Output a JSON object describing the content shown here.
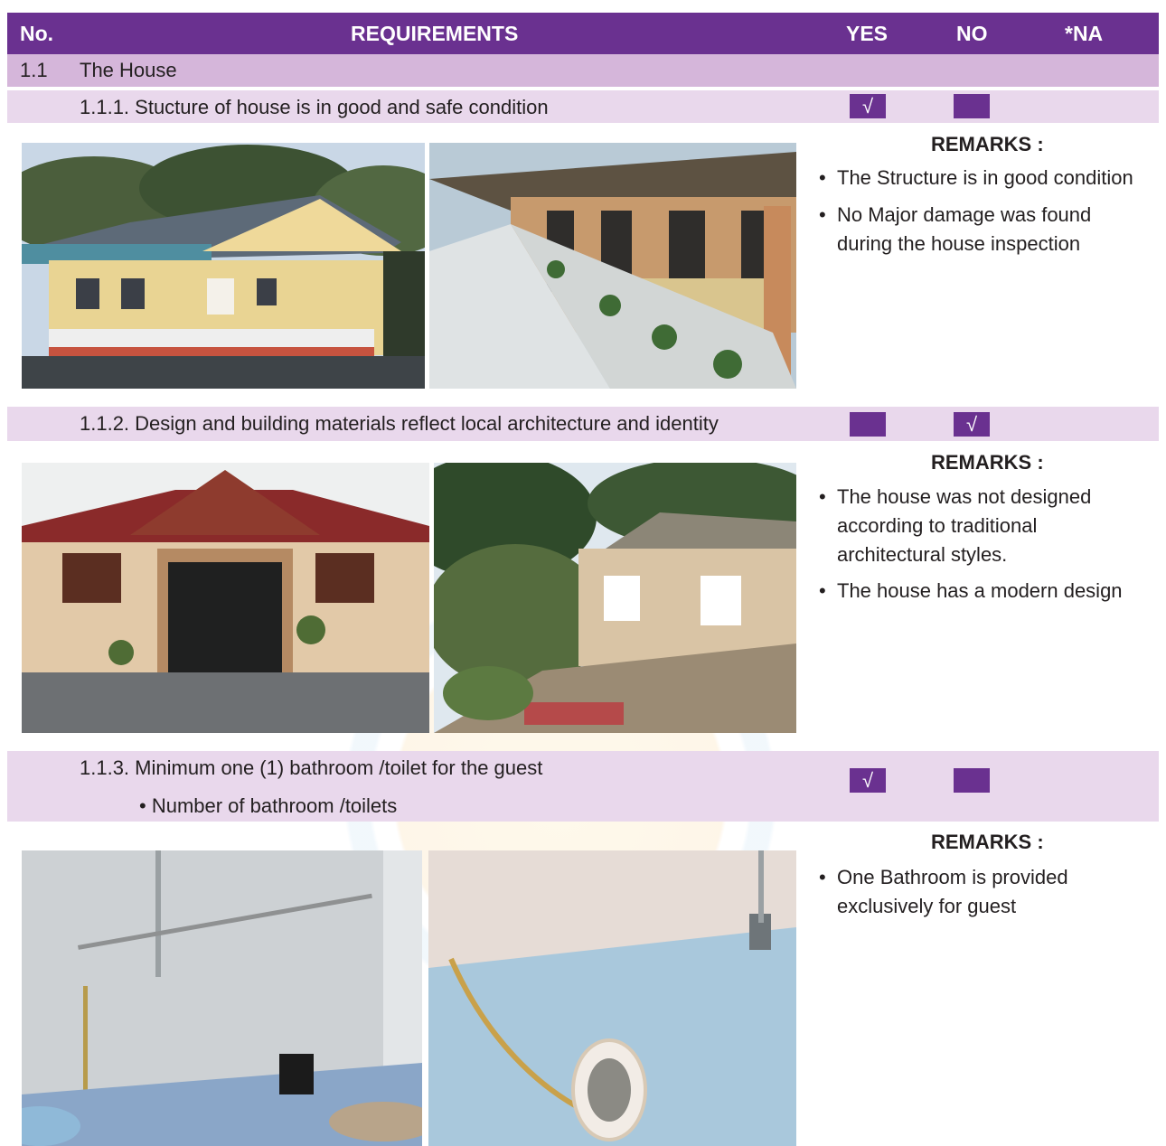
{
  "header": {
    "no": "No.",
    "requirements": "REQUIREMENTS",
    "yes": "YES",
    "no_col": "NO",
    "na": "*NA"
  },
  "section": {
    "number": "1.1",
    "title": "The House"
  },
  "items": [
    {
      "label": "1.1.1. Stucture of house is in good and safe condition",
      "yes_mark": "√",
      "no_mark": "",
      "remarks_title": "REMARKS :",
      "remarks": [
        "The Structure is in good condition",
        "No Major damage was found during the house inspection"
      ],
      "photos": [
        "house-exterior-photo",
        "house-veranda-photo"
      ]
    },
    {
      "label": "1.1.2. Design and building materials reflect local architecture and identity",
      "yes_mark": "",
      "no_mark": "√",
      "remarks_title": "REMARKS :",
      "remarks": [
        "The house was not designed according to traditional architectural styles.",
        "The house has a modern design"
      ],
      "photos": [
        "house-front-photo",
        "house-side-photo"
      ]
    },
    {
      "label": "1.1.3. Minimum one (1) bathroom /toilet for the guest",
      "sublabel": "Number of bathroom /toilets",
      "yes_mark": "√",
      "no_mark": "",
      "remarks_title": "REMARKS :",
      "remarks": [
        "One Bathroom is provided exclusively for guest"
      ],
      "photos": [
        "bathroom-shower-photo",
        "bathroom-toilet-photo"
      ]
    }
  ],
  "colors": {
    "header": "#6a3190",
    "section_row": "#d5b6da",
    "item_row": "#e9d8ec",
    "checkbox": "#6a3190"
  },
  "bullet": "•"
}
